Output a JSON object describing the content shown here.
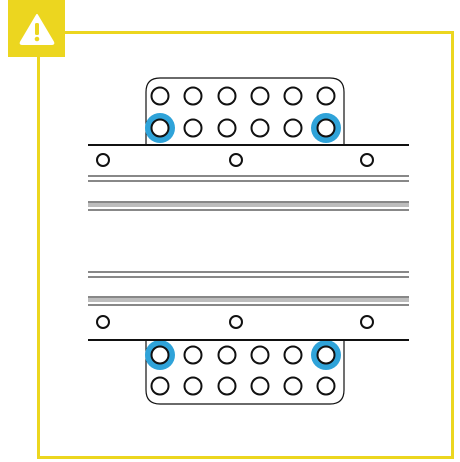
{
  "warning": {
    "icon": "warning-triangle-icon",
    "color": "#ecd61f"
  },
  "diagram": {
    "highlight_color": "#2fa3d9",
    "line_color": "#111111",
    "rail_gray": "#bdbdbd",
    "top_plate": {
      "rows": 2,
      "cols": 6,
      "highlighted": [
        [
          1,
          0
        ],
        [
          1,
          5
        ]
      ]
    },
    "bottom_plate": {
      "rows": 2,
      "cols": 6,
      "highlighted": [
        [
          0,
          0
        ],
        [
          0,
          5
        ]
      ]
    }
  }
}
